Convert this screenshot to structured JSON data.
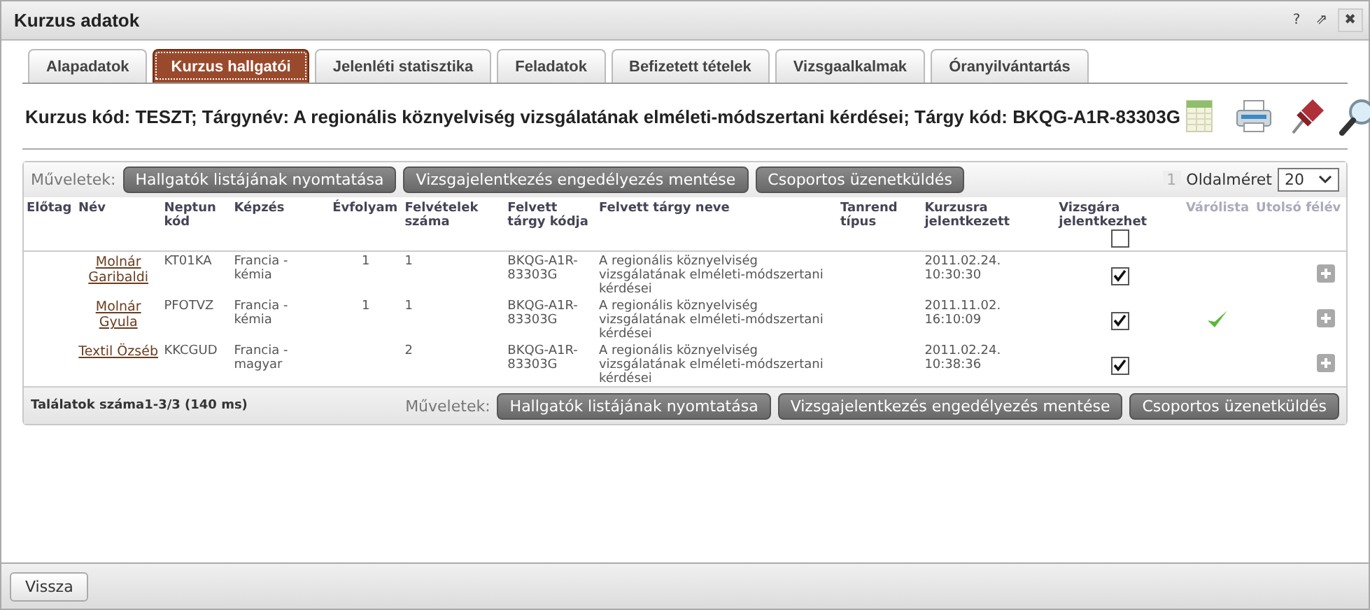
{
  "window": {
    "title": "Kurzus adatok",
    "controls": [
      "?",
      "⇗",
      "✖"
    ]
  },
  "tabs": [
    {
      "label": "Alapadatok",
      "selected": false
    },
    {
      "label": "Kurzus hallgatói",
      "selected": true
    },
    {
      "label": "Jelenléti statisztika",
      "selected": false
    },
    {
      "label": "Feladatok",
      "selected": false
    },
    {
      "label": "Befizetett tételek",
      "selected": false
    },
    {
      "label": "Vizsgaalkalmak",
      "selected": false
    },
    {
      "label": "Óranyilvántartás",
      "selected": false
    }
  ],
  "course_info": "Kurzus kód: TESZT; Tárgynév: A regionális köznyelviség vizsgálatának elméleti-módszertani kérdései; Tárgy kód: BKQG-A1R-83303G",
  "grid": {
    "top_actions": {
      "label": "Műveletek:",
      "buttons": [
        "Hallgatók listájának nyomtatása",
        "Vizsgajelentkezés engedélyezés mentése",
        "Csoportos üzenetküldés"
      ]
    },
    "bottom_actions": {
      "label": "Műveletek:",
      "buttons": [
        "Hallgatók listájának nyomtatása",
        "Vizsgajelentkezés engedélyezés mentése",
        "Csoportos üzenetküldés"
      ]
    },
    "page": "1",
    "page_size_label": "Oldalméret",
    "page_size": "20",
    "columns": [
      "Előtag",
      "Név",
      "Neptun kód",
      "Képzés",
      "Évfolyam",
      "Felvételek száma",
      "Felvett tárgy kódja",
      "Felvett tárgy neve",
      "Tanrend típus",
      "Kurzusra jelentkezett",
      "Vizsgára jelentkezhet",
      "Várólista",
      "Utolsó félév"
    ],
    "header_checkbox": {
      "checked": false
    },
    "rows": [
      {
        "name": "Molnár Garibaldi",
        "neptun": "KT01KA",
        "training": "Francia - kémia",
        "year": "1",
        "enrollments": "1",
        "subject_code": "BKQG-A1R-83303G",
        "subject_name": "A regionális köznyelviség vizsgálatának elméleti-módszertani kérdései",
        "registered": "2011.02.24. 10:30:30",
        "exam_allowed": true,
        "waitlist": false
      },
      {
        "name": "Molnár Gyula",
        "neptun": "PFOTVZ",
        "training": "Francia - kémia",
        "year": "1",
        "enrollments": "1",
        "subject_code": "BKQG-A1R-83303G",
        "subject_name": "A regionális köznyelviség vizsgálatának elméleti-módszertani kérdései",
        "registered": "2011.11.02. 16:10:09",
        "exam_allowed": true,
        "waitlist": true
      },
      {
        "name": "Textil Özséb",
        "neptun": "KKCGUD",
        "training": "Francia - magyar",
        "year": "",
        "enrollments": "2",
        "subject_code": "BKQG-A1R-83303G",
        "subject_name": "A regionális köznyelviség vizsgálatának elméleti-módszertani kérdései",
        "registered": "2011.02.24. 10:38:36",
        "exam_allowed": true,
        "waitlist": false
      }
    ],
    "results": "Találatok száma1-3/3 (140 ms)"
  },
  "footer": {
    "button": "Vissza"
  }
}
